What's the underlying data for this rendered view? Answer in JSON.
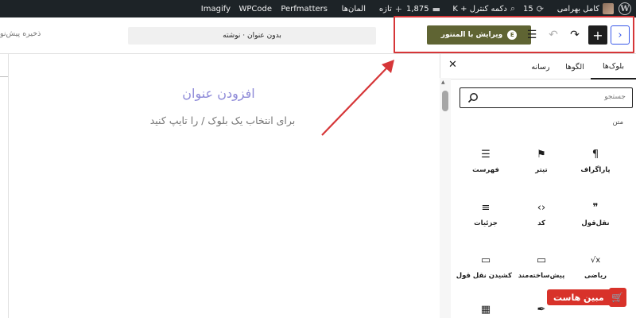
{
  "admin_bar": {
    "user_name": "کامل بهرامی",
    "updates_count": "15",
    "control_shortcut": "دکمه کنترل + K",
    "comments_count": "1,875",
    "new_label": "تازه",
    "elements_label": "المان‌ها",
    "perfmatters": "Perfmatters",
    "wpcode": "WPCode",
    "imagify": "Imagify"
  },
  "header": {
    "save_draft": "ذخیره پیش‌نو",
    "document_title": "بدون عنوان · نوشته",
    "elementor_button": "ویرایش با المنتور"
  },
  "canvas": {
    "add_title_placeholder": "افزودن عنوان",
    "choose_block_hint": "برای انتخاب یک بلوک / را تایپ کنید"
  },
  "sidebar": {
    "tabs": [
      "بلوک‌ها",
      "الگوها",
      "رسانه"
    ],
    "search_placeholder": "جستجو",
    "category": "متن",
    "blocks": [
      {
        "label": "پاراگراف",
        "icon": "paragraph-icon",
        "glyph": "¶"
      },
      {
        "label": "تیتر",
        "icon": "bookmark-icon",
        "glyph": "⚑"
      },
      {
        "label": "فهرست",
        "icon": "list-icon",
        "glyph": "☰"
      },
      {
        "label": "نقل‌قول",
        "icon": "quote-icon",
        "glyph": "❞"
      },
      {
        "label": "کد",
        "icon": "code-icon",
        "glyph": "‹›"
      },
      {
        "label": "جزئیات",
        "icon": "details-icon",
        "glyph": "≡"
      },
      {
        "label": "ریاضی",
        "icon": "math-icon",
        "glyph": "√x"
      },
      {
        "label": "پیش‌ساخته‌مند",
        "icon": "preformatted-icon",
        "glyph": "▭"
      },
      {
        "label": "کشیدن نقل قول",
        "icon": "pullquote-icon",
        "glyph": "▭"
      },
      {
        "label": "",
        "icon": "table-icon",
        "glyph": "▦"
      },
      {
        "label": "",
        "icon": "verse-icon",
        "glyph": "✒"
      },
      {
        "label": "",
        "icon": "table-icon-2",
        "glyph": "▦"
      }
    ]
  },
  "watermark": {
    "text": "مبین هاست"
  },
  "colors": {
    "admin_bar": "#1d2327",
    "elementor": "#5f6433",
    "highlight": "#d63638",
    "accent": "#3858e9",
    "title_placeholder": "#8e8ad8"
  }
}
